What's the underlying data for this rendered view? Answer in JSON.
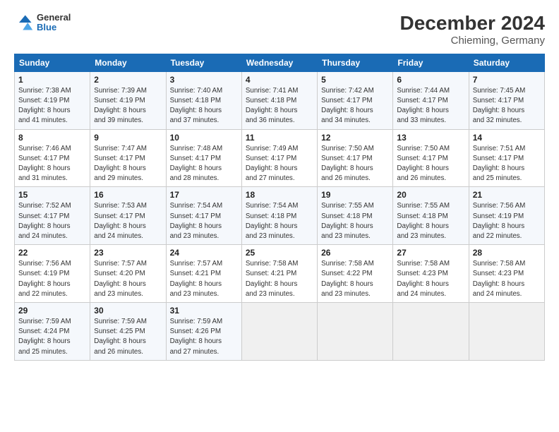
{
  "header": {
    "logo_line1": "General",
    "logo_line2": "Blue",
    "title": "December 2024",
    "subtitle": "Chieming, Germany"
  },
  "days_of_week": [
    "Sunday",
    "Monday",
    "Tuesday",
    "Wednesday",
    "Thursday",
    "Friday",
    "Saturday"
  ],
  "weeks": [
    [
      {
        "day": "1",
        "sunrise": "7:38 AM",
        "sunset": "4:19 PM",
        "daylight": "8 hours and 41 minutes."
      },
      {
        "day": "2",
        "sunrise": "7:39 AM",
        "sunset": "4:19 PM",
        "daylight": "8 hours and 39 minutes."
      },
      {
        "day": "3",
        "sunrise": "7:40 AM",
        "sunset": "4:18 PM",
        "daylight": "8 hours and 37 minutes."
      },
      {
        "day": "4",
        "sunrise": "7:41 AM",
        "sunset": "4:18 PM",
        "daylight": "8 hours and 36 minutes."
      },
      {
        "day": "5",
        "sunrise": "7:42 AM",
        "sunset": "4:17 PM",
        "daylight": "8 hours and 34 minutes."
      },
      {
        "day": "6",
        "sunrise": "7:44 AM",
        "sunset": "4:17 PM",
        "daylight": "8 hours and 33 minutes."
      },
      {
        "day": "7",
        "sunrise": "7:45 AM",
        "sunset": "4:17 PM",
        "daylight": "8 hours and 32 minutes."
      }
    ],
    [
      {
        "day": "8",
        "sunrise": "7:46 AM",
        "sunset": "4:17 PM",
        "daylight": "8 hours and 31 minutes."
      },
      {
        "day": "9",
        "sunrise": "7:47 AM",
        "sunset": "4:17 PM",
        "daylight": "8 hours and 29 minutes."
      },
      {
        "day": "10",
        "sunrise": "7:48 AM",
        "sunset": "4:17 PM",
        "daylight": "8 hours and 28 minutes."
      },
      {
        "day": "11",
        "sunrise": "7:49 AM",
        "sunset": "4:17 PM",
        "daylight": "8 hours and 27 minutes."
      },
      {
        "day": "12",
        "sunrise": "7:50 AM",
        "sunset": "4:17 PM",
        "daylight": "8 hours and 26 minutes."
      },
      {
        "day": "13",
        "sunrise": "7:50 AM",
        "sunset": "4:17 PM",
        "daylight": "8 hours and 26 minutes."
      },
      {
        "day": "14",
        "sunrise": "7:51 AM",
        "sunset": "4:17 PM",
        "daylight": "8 hours and 25 minutes."
      }
    ],
    [
      {
        "day": "15",
        "sunrise": "7:52 AM",
        "sunset": "4:17 PM",
        "daylight": "8 hours and 24 minutes."
      },
      {
        "day": "16",
        "sunrise": "7:53 AM",
        "sunset": "4:17 PM",
        "daylight": "8 hours and 24 minutes."
      },
      {
        "day": "17",
        "sunrise": "7:54 AM",
        "sunset": "4:17 PM",
        "daylight": "8 hours and 23 minutes."
      },
      {
        "day": "18",
        "sunrise": "7:54 AM",
        "sunset": "4:18 PM",
        "daylight": "8 hours and 23 minutes."
      },
      {
        "day": "19",
        "sunrise": "7:55 AM",
        "sunset": "4:18 PM",
        "daylight": "8 hours and 23 minutes."
      },
      {
        "day": "20",
        "sunrise": "7:55 AM",
        "sunset": "4:18 PM",
        "daylight": "8 hours and 23 minutes."
      },
      {
        "day": "21",
        "sunrise": "7:56 AM",
        "sunset": "4:19 PM",
        "daylight": "8 hours and 22 minutes."
      }
    ],
    [
      {
        "day": "22",
        "sunrise": "7:56 AM",
        "sunset": "4:19 PM",
        "daylight": "8 hours and 22 minutes."
      },
      {
        "day": "23",
        "sunrise": "7:57 AM",
        "sunset": "4:20 PM",
        "daylight": "8 hours and 23 minutes."
      },
      {
        "day": "24",
        "sunrise": "7:57 AM",
        "sunset": "4:21 PM",
        "daylight": "8 hours and 23 minutes."
      },
      {
        "day": "25",
        "sunrise": "7:58 AM",
        "sunset": "4:21 PM",
        "daylight": "8 hours and 23 minutes."
      },
      {
        "day": "26",
        "sunrise": "7:58 AM",
        "sunset": "4:22 PM",
        "daylight": "8 hours and 23 minutes."
      },
      {
        "day": "27",
        "sunrise": "7:58 AM",
        "sunset": "4:23 PM",
        "daylight": "8 hours and 24 minutes."
      },
      {
        "day": "28",
        "sunrise": "7:58 AM",
        "sunset": "4:23 PM",
        "daylight": "8 hours and 24 minutes."
      }
    ],
    [
      {
        "day": "29",
        "sunrise": "7:59 AM",
        "sunset": "4:24 PM",
        "daylight": "8 hours and 25 minutes."
      },
      {
        "day": "30",
        "sunrise": "7:59 AM",
        "sunset": "4:25 PM",
        "daylight": "8 hours and 26 minutes."
      },
      {
        "day": "31",
        "sunrise": "7:59 AM",
        "sunset": "4:26 PM",
        "daylight": "8 hours and 27 minutes."
      },
      null,
      null,
      null,
      null
    ]
  ]
}
